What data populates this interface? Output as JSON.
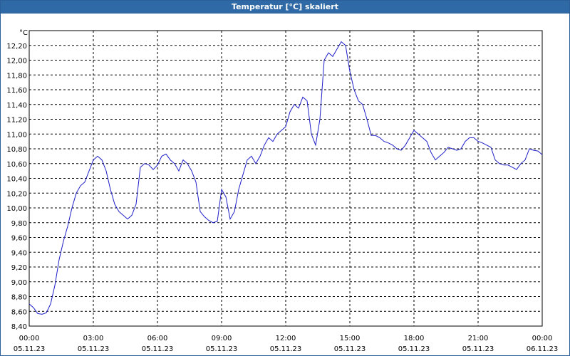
{
  "window": {
    "title": "Temperatur [°C] skaliert"
  },
  "colors": {
    "series": "#1e1ec8",
    "title_bar": "#2f6aa6",
    "grid": "#000000"
  },
  "chart_data": {
    "type": "line",
    "title": "Temperatur [°C] skaliert",
    "ylabel": "°C",
    "xlabel": "",
    "grid": true,
    "ylim": [
      8.4,
      12.4
    ],
    "yticks": [
      8.4,
      8.6,
      8.8,
      9.0,
      9.2,
      9.4,
      9.6,
      9.8,
      10.0,
      10.2,
      10.4,
      10.6,
      10.8,
      11.0,
      11.2,
      11.4,
      11.6,
      11.8,
      12.0,
      12.2
    ],
    "ytick_labels": [
      "8,40",
      "8,60",
      "8,80",
      "9,00",
      "9,20",
      "9,40",
      "9,60",
      "9,80",
      "10,00",
      "10,20",
      "10,40",
      "10,60",
      "10,80",
      "11,00",
      "11,20",
      "11,40",
      "11,60",
      "11,80",
      "12,00",
      "12,20"
    ],
    "xlim": [
      0,
      24
    ],
    "xticks": [
      0,
      3,
      6,
      9,
      12,
      15,
      18,
      21,
      24
    ],
    "xtick_labels": [
      {
        "time": "00:00",
        "date": "05.11.23"
      },
      {
        "time": "03:00",
        "date": "05.11.23"
      },
      {
        "time": "06:00",
        "date": "05.11.23"
      },
      {
        "time": "09:00",
        "date": "05.11.23"
      },
      {
        "time": "12:00",
        "date": "05.11.23"
      },
      {
        "time": "15:00",
        "date": "05.11.23"
      },
      {
        "time": "18:00",
        "date": "05.11.23"
      },
      {
        "time": "21:00",
        "date": "05.11.23"
      },
      {
        "time": "00:00",
        "date": "06.11.23"
      }
    ],
    "series": [
      {
        "x": [
          0,
          0.2,
          0.4,
          0.6,
          0.8,
          1.0,
          1.2,
          1.4,
          1.6,
          1.8,
          2.0,
          2.2,
          2.4,
          2.6,
          2.8,
          3.0,
          3.2,
          3.4,
          3.6,
          3.8,
          4.0,
          4.2,
          4.4,
          4.6,
          4.8,
          5.0,
          5.2,
          5.4,
          5.6,
          5.8,
          6.0,
          6.2,
          6.4,
          6.6,
          6.8,
          7.0,
          7.2,
          7.4,
          7.6,
          7.8,
          8.0,
          8.2,
          8.4,
          8.6,
          8.8,
          9.0,
          9.2,
          9.4,
          9.6,
          9.8,
          10.0,
          10.2,
          10.4,
          10.6,
          10.8,
          11.0,
          11.2,
          11.4,
          11.6,
          11.8,
          12.0,
          12.2,
          12.4,
          12.6,
          12.8,
          13.0,
          13.2,
          13.4,
          13.6,
          13.8,
          14.0,
          14.2,
          14.4,
          14.6,
          14.8,
          15.0,
          15.2,
          15.4,
          15.6,
          15.8,
          16.0,
          16.2,
          16.4,
          16.6,
          16.8,
          17.0,
          17.2,
          17.4,
          17.6,
          17.8,
          18.0,
          18.2,
          18.4,
          18.6,
          18.8,
          19.0,
          19.2,
          19.4,
          19.6,
          19.8,
          20.0,
          20.2,
          20.4,
          20.6,
          20.8,
          21.0,
          21.2,
          21.4,
          21.6,
          21.8,
          22.0,
          22.2,
          22.4,
          22.6,
          22.8,
          23.0,
          23.2,
          23.4,
          23.6,
          23.8,
          24.0
        ],
        "values": [
          8.7,
          8.65,
          8.57,
          8.56,
          8.58,
          8.7,
          8.95,
          9.3,
          9.55,
          9.75,
          10.0,
          10.2,
          10.3,
          10.35,
          10.5,
          10.65,
          10.7,
          10.65,
          10.5,
          10.25,
          10.05,
          9.95,
          9.9,
          9.85,
          9.9,
          10.05,
          10.55,
          10.6,
          10.58,
          10.52,
          10.58,
          10.7,
          10.73,
          10.65,
          10.6,
          10.5,
          10.65,
          10.6,
          10.5,
          10.35,
          9.95,
          9.88,
          9.83,
          9.8,
          9.82,
          10.25,
          10.15,
          9.85,
          9.95,
          10.25,
          10.45,
          10.65,
          10.7,
          10.6,
          10.7,
          10.85,
          10.95,
          10.9,
          11.0,
          11.05,
          11.1,
          11.3,
          11.4,
          11.35,
          11.5,
          11.45,
          11.0,
          10.85,
          11.2,
          12.0,
          12.1,
          12.05,
          12.15,
          12.25,
          12.2,
          11.85,
          11.6,
          11.45,
          11.4,
          11.2,
          10.98,
          10.98,
          10.95,
          10.9,
          10.88,
          10.85,
          10.8,
          10.78,
          10.85,
          10.95,
          11.05,
          11.0,
          10.95,
          10.9,
          10.75,
          10.65,
          10.7,
          10.75,
          10.82,
          10.8,
          10.78,
          10.8,
          10.9,
          10.95,
          10.95,
          10.9,
          10.88,
          10.85,
          10.82,
          10.65,
          10.6,
          10.58,
          10.58,
          10.55,
          10.52,
          10.6,
          10.65,
          10.8,
          10.78,
          10.77,
          10.72
        ]
      }
    ]
  }
}
